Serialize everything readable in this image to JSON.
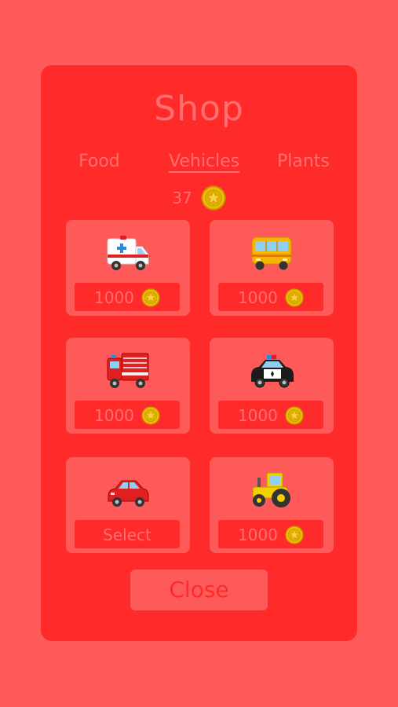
{
  "shop": {
    "title": "Shop",
    "tabs": [
      {
        "label": "Food",
        "active": false
      },
      {
        "label": "Vehicles",
        "active": true
      },
      {
        "label": "Plants",
        "active": false
      }
    ],
    "coin_balance": "37",
    "items": [
      {
        "vehicle": "ambulance",
        "price": "1000",
        "action": "buy"
      },
      {
        "vehicle": "bus",
        "price": "1000",
        "action": "buy"
      },
      {
        "vehicle": "fire-truck",
        "price": "1000",
        "action": "buy"
      },
      {
        "vehicle": "police-car",
        "price": "1000",
        "action": "buy"
      },
      {
        "vehicle": "red-car",
        "select_label": "Select",
        "action": "select"
      },
      {
        "vehicle": "tractor",
        "price": "1000",
        "action": "buy"
      }
    ],
    "close_label": "Close"
  },
  "icons": {
    "coin": "coin-icon",
    "ambulance": "ambulance-icon",
    "bus": "bus-icon",
    "fire_truck": "fire-truck-icon",
    "police_car": "police-car-icon",
    "red_car": "red-car-icon",
    "tractor": "tractor-icon"
  },
  "colors": {
    "background": "#ff5a5a",
    "panel": "#ff2a2a",
    "text": "#ff6f6f",
    "coin_gold": "#e8b800"
  }
}
